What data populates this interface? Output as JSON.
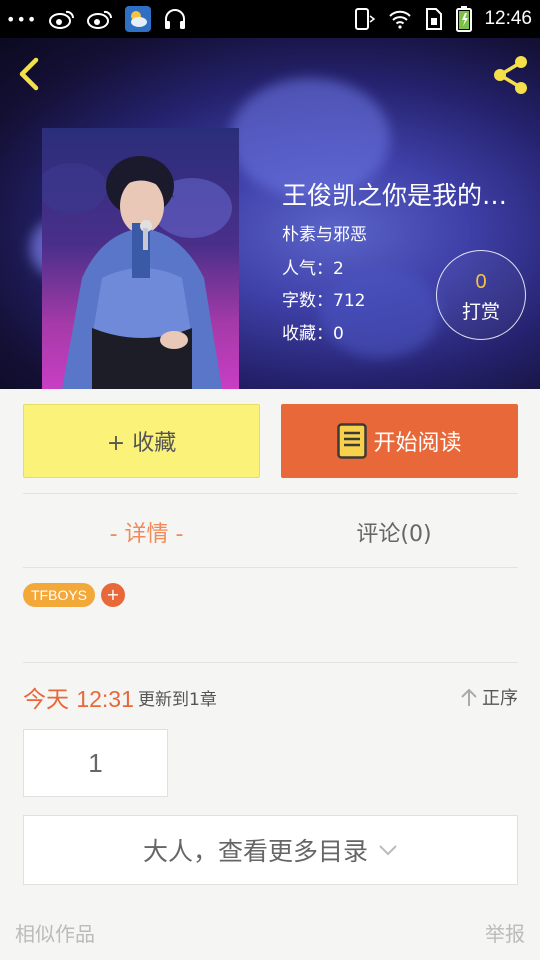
{
  "status_bar": {
    "time": "12:46",
    "dots": "•••",
    "icons": [
      "weibo-icon",
      "weibo-icon",
      "weather-icon",
      "headset-icon",
      "phone-signal-icon",
      "wifi-icon",
      "sim-icon",
      "battery-icon"
    ]
  },
  "book": {
    "title": "王俊凯之你是我的…",
    "author": "朴素与邪恶",
    "popularity": "人气：2",
    "word_count": "字数：712",
    "favorites": "收藏：0"
  },
  "reward": {
    "count": "0",
    "label": "打赏"
  },
  "actions": {
    "favorite_label": "+ 收藏",
    "read_label": "开始阅读"
  },
  "tabs": {
    "detail": "- 详情 -",
    "comment": "评论(0)"
  },
  "tags": [
    {
      "label": "TFBOYS"
    }
  ],
  "tag_add": "+",
  "update": {
    "day": "今天",
    "time": "12:31",
    "chapters": "更新到1章",
    "sort": "正序"
  },
  "chapters": [
    {
      "label": "1"
    }
  ],
  "more_catalog": "大人，查看更多目录",
  "footer": {
    "similar": "相似作品",
    "report": "举报"
  },
  "colors": {
    "accent": "#e8683a",
    "favorite_bg": "#fbf27a",
    "tag_bg": "#f3a83a",
    "page_bg": "#f5f5f3"
  }
}
